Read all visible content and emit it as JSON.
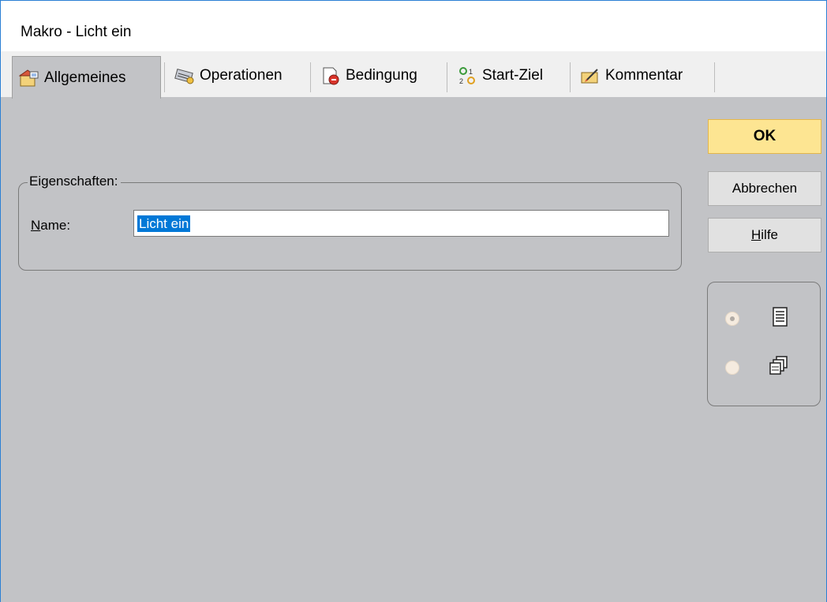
{
  "window": {
    "title": "Makro - Licht ein"
  },
  "tabs": [
    {
      "label": "Allgemeines",
      "icon": "general-properties-icon",
      "active": true
    },
    {
      "label": "Operationen",
      "icon": "operations-icon",
      "active": false
    },
    {
      "label": "Bedingung",
      "icon": "condition-icon",
      "active": false
    },
    {
      "label": "Start-Ziel",
      "icon": "start-target-icon",
      "active": false
    },
    {
      "label": "Kommentar",
      "icon": "comment-icon",
      "active": false
    }
  ],
  "properties": {
    "group_label": "Eigenschaften:",
    "name_label_accel": "N",
    "name_label_rest": "ame:",
    "name_value": "Licht ein"
  },
  "buttons": {
    "ok": "OK",
    "cancel": "Abbrechen",
    "help_accel": "H",
    "help_rest": "ilfe"
  },
  "view_options": [
    {
      "icon": "list-view-icon",
      "selected": true
    },
    {
      "icon": "cascade-windows-icon",
      "selected": false
    }
  ],
  "colors": {
    "ok_button": "#fde592",
    "selection": "#0078d7",
    "panel_bg": "#c2c3c6"
  }
}
